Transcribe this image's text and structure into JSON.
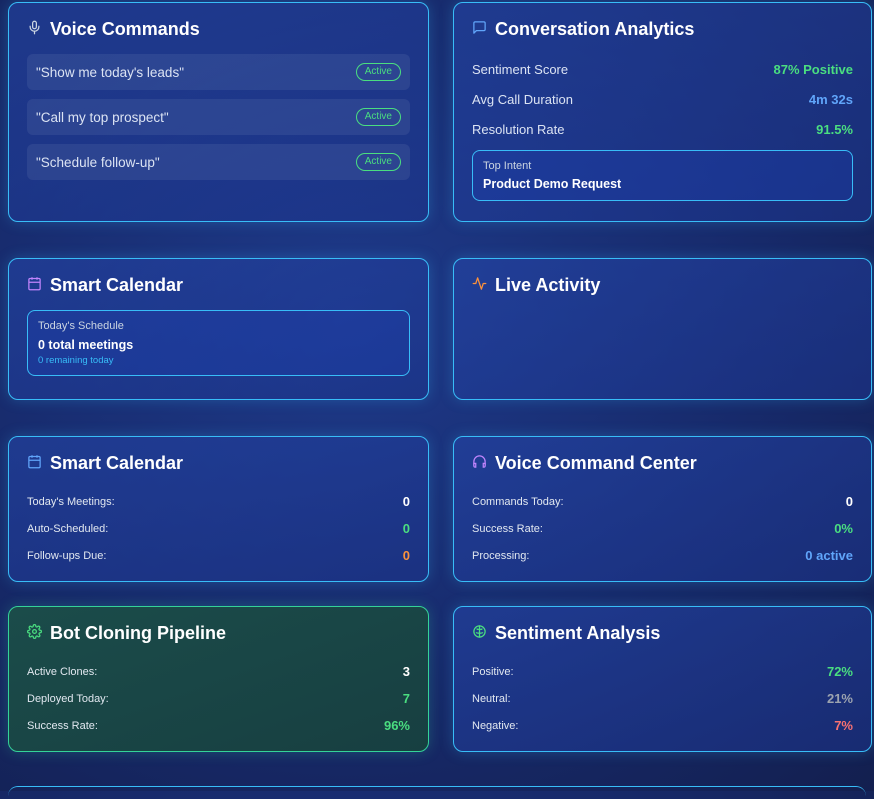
{
  "voice_commands": {
    "title": "Voice Commands",
    "icon": "mic-icon",
    "items": [
      {
        "text": "\"Show me today's leads\"",
        "status": "Active"
      },
      {
        "text": "\"Call my top prospect\"",
        "status": "Active"
      },
      {
        "text": "\"Schedule follow-up\"",
        "status": "Active"
      }
    ]
  },
  "conversation_analytics": {
    "title": "Conversation Analytics",
    "icon": "message-square-icon",
    "rows": [
      {
        "label": "Sentiment Score",
        "value": "87% Positive",
        "color": "#4ade80"
      },
      {
        "label": "Avg Call Duration",
        "value": "4m 32s",
        "color": "#60a5fa"
      },
      {
        "label": "Resolution Rate",
        "value": "91.5%",
        "color": "#4ade80"
      }
    ],
    "top_intent": {
      "label": "Top Intent",
      "value": "Product Demo Request"
    }
  },
  "smart_calendar_1": {
    "title": "Smart Calendar",
    "icon": "calendar-icon",
    "schedule": {
      "label": "Today's Schedule",
      "total": "0 total meetings",
      "remaining": "0 remaining today"
    }
  },
  "live_activity": {
    "title": "Live Activity",
    "icon": "activity-icon"
  },
  "smart_calendar_2": {
    "title": "Smart Calendar",
    "icon": "calendar-icon",
    "rows": [
      {
        "label": "Today's Meetings:",
        "value": "0",
        "color": "#ffffff"
      },
      {
        "label": "Auto-Scheduled:",
        "value": "0",
        "color": "#4ade80"
      },
      {
        "label": "Follow-ups Due:",
        "value": "0",
        "color": "#fb923c"
      }
    ]
  },
  "voice_command_center": {
    "title": "Voice Command Center",
    "icon": "headphones-icon",
    "rows": [
      {
        "label": "Commands Today:",
        "value": "0",
        "color": "#ffffff"
      },
      {
        "label": "Success Rate:",
        "value": "0%",
        "color": "#4ade80"
      },
      {
        "label": "Processing:",
        "value": "0 active",
        "color": "#60a5fa"
      }
    ]
  },
  "bot_cloning": {
    "title": "Bot Cloning Pipeline",
    "icon": "gear-icon",
    "rows": [
      {
        "label": "Active Clones:",
        "value": "3",
        "color": "#ffffff"
      },
      {
        "label": "Deployed Today:",
        "value": "7",
        "color": "#4ade80"
      },
      {
        "label": "Success Rate:",
        "value": "96%",
        "color": "#4ade80"
      }
    ]
  },
  "sentiment_analysis": {
    "title": "Sentiment Analysis",
    "icon": "brain-icon",
    "rows": [
      {
        "label": "Positive:",
        "value": "72%",
        "color": "#4ade80"
      },
      {
        "label": "Neutral:",
        "value": "21%",
        "color": "#9ca3af"
      },
      {
        "label": "Negative:",
        "value": "7%",
        "color": "#f87171"
      }
    ]
  }
}
